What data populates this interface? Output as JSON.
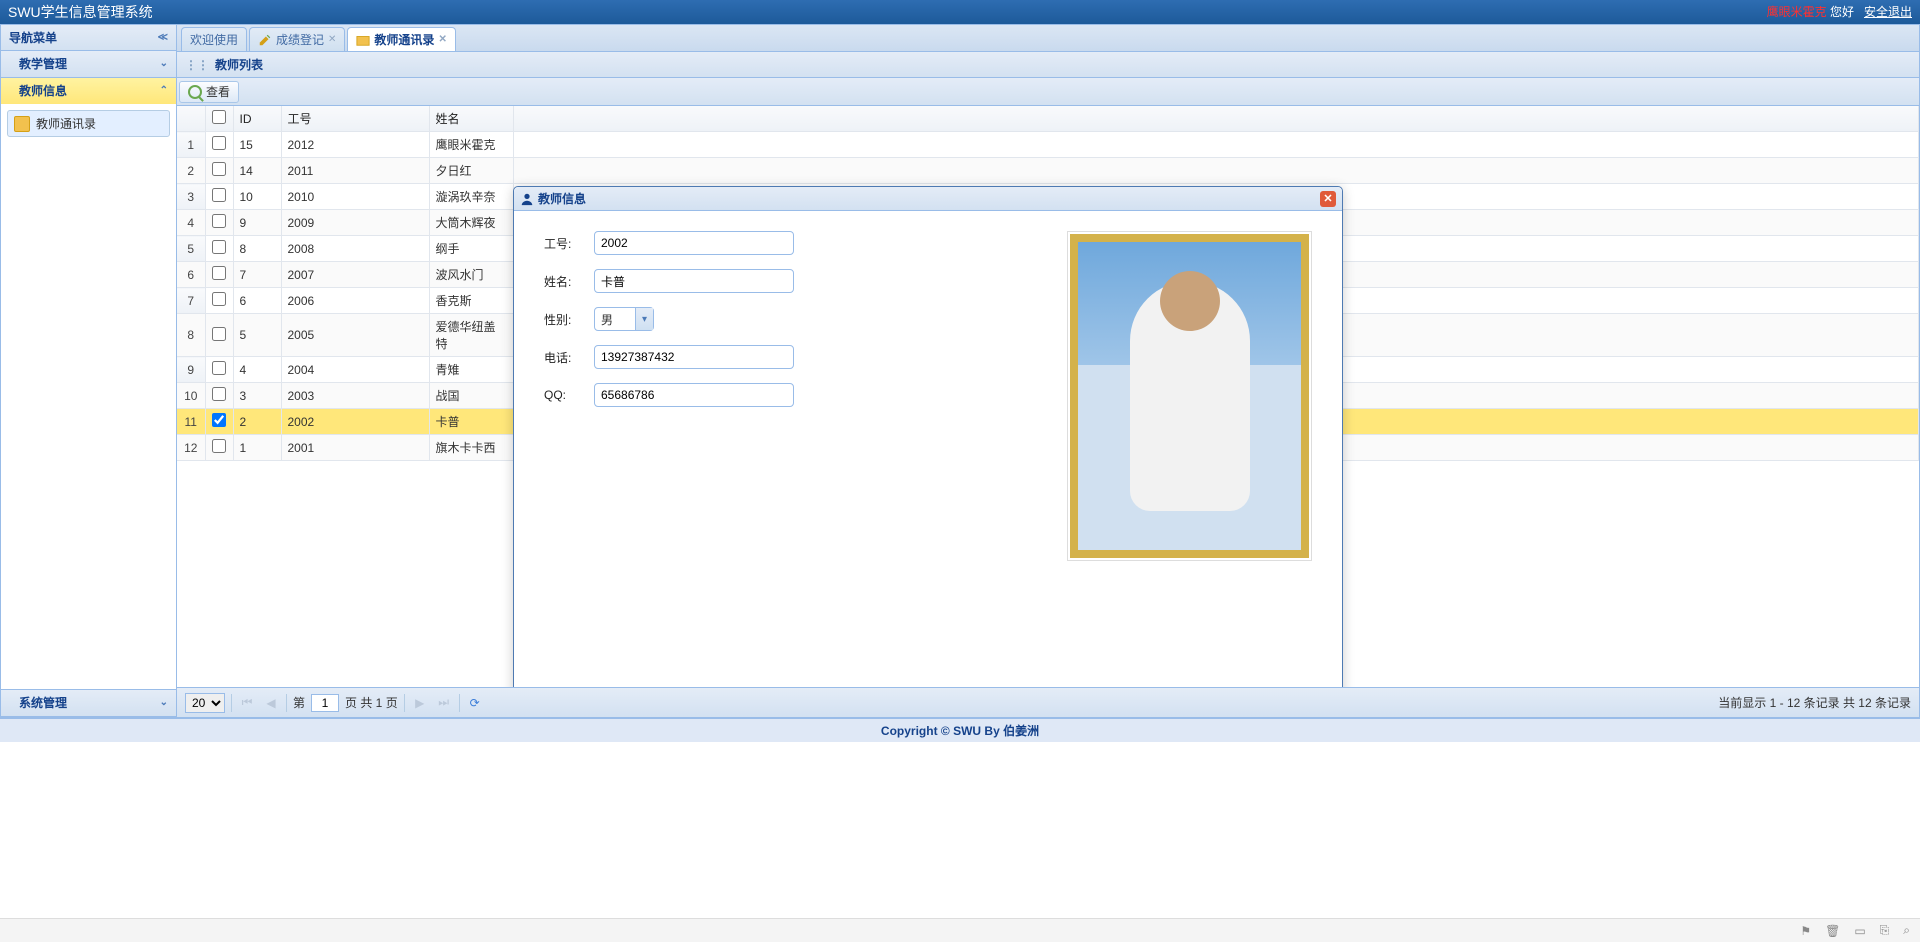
{
  "header": {
    "title": "SWU学生信息管理系统",
    "username": "鹰眼米霍克",
    "greeting": "您好",
    "logout": "安全退出"
  },
  "sidebar": {
    "title": "导航菜单",
    "sections": [
      {
        "label": "教学管理",
        "expanded": false
      },
      {
        "label": "教师信息",
        "expanded": true,
        "items": [
          {
            "label": "教师通讯录"
          }
        ]
      },
      {
        "label": "系统管理",
        "expanded": false
      }
    ]
  },
  "tabs": [
    {
      "label": "欢迎使用",
      "closable": false,
      "icon": null
    },
    {
      "label": "成绩登记",
      "closable": true,
      "icon": "pencil"
    },
    {
      "label": "教师通讯录",
      "closable": true,
      "icon": "folder",
      "active": true
    }
  ],
  "panel": {
    "title": "教师列表",
    "view_button": "查看"
  },
  "grid": {
    "columns": [
      "ID",
      "工号",
      "姓名"
    ],
    "rows": [
      {
        "n": 1,
        "id": "15",
        "jobno": "2012",
        "name": "鹰眼米霍克",
        "checked": false
      },
      {
        "n": 2,
        "id": "14",
        "jobno": "2011",
        "name": "夕日红",
        "checked": false
      },
      {
        "n": 3,
        "id": "10",
        "jobno": "2010",
        "name": "漩涡玖辛奈",
        "checked": false
      },
      {
        "n": 4,
        "id": "9",
        "jobno": "2009",
        "name": "大筒木辉夜",
        "checked": false
      },
      {
        "n": 5,
        "id": "8",
        "jobno": "2008",
        "name": "纲手",
        "checked": false
      },
      {
        "n": 6,
        "id": "7",
        "jobno": "2007",
        "name": "波风水门",
        "checked": false
      },
      {
        "n": 7,
        "id": "6",
        "jobno": "2006",
        "name": "香克斯",
        "checked": false
      },
      {
        "n": 8,
        "id": "5",
        "jobno": "2005",
        "name": "爱德华纽盖特",
        "checked": false
      },
      {
        "n": 9,
        "id": "4",
        "jobno": "2004",
        "name": "青雉",
        "checked": false
      },
      {
        "n": 10,
        "id": "3",
        "jobno": "2003",
        "name": "战国",
        "checked": false
      },
      {
        "n": 11,
        "id": "2",
        "jobno": "2002",
        "name": "卡普",
        "checked": true,
        "selected": true
      },
      {
        "n": 12,
        "id": "1",
        "jobno": "2001",
        "name": "旗木卡卡西",
        "checked": false
      }
    ]
  },
  "pager": {
    "page_size": "20",
    "page_label_prefix": "第",
    "page_value": "1",
    "page_label_suffix": "页 共 1 页",
    "info": "当前显示 1 - 12 条记录 共 12 条记录"
  },
  "dialog": {
    "title": "教师信息",
    "fields": {
      "jobno_label": "工号:",
      "jobno_value": "2002",
      "name_label": "姓名:",
      "name_value": "卡普",
      "sex_label": "性别:",
      "sex_value": "男",
      "phone_label": "电话:",
      "phone_value": "13927387432",
      "qq_label": "QQ:",
      "qq_value": "65686786"
    }
  },
  "footer": "Copyright © SWU By 伯姜洲"
}
